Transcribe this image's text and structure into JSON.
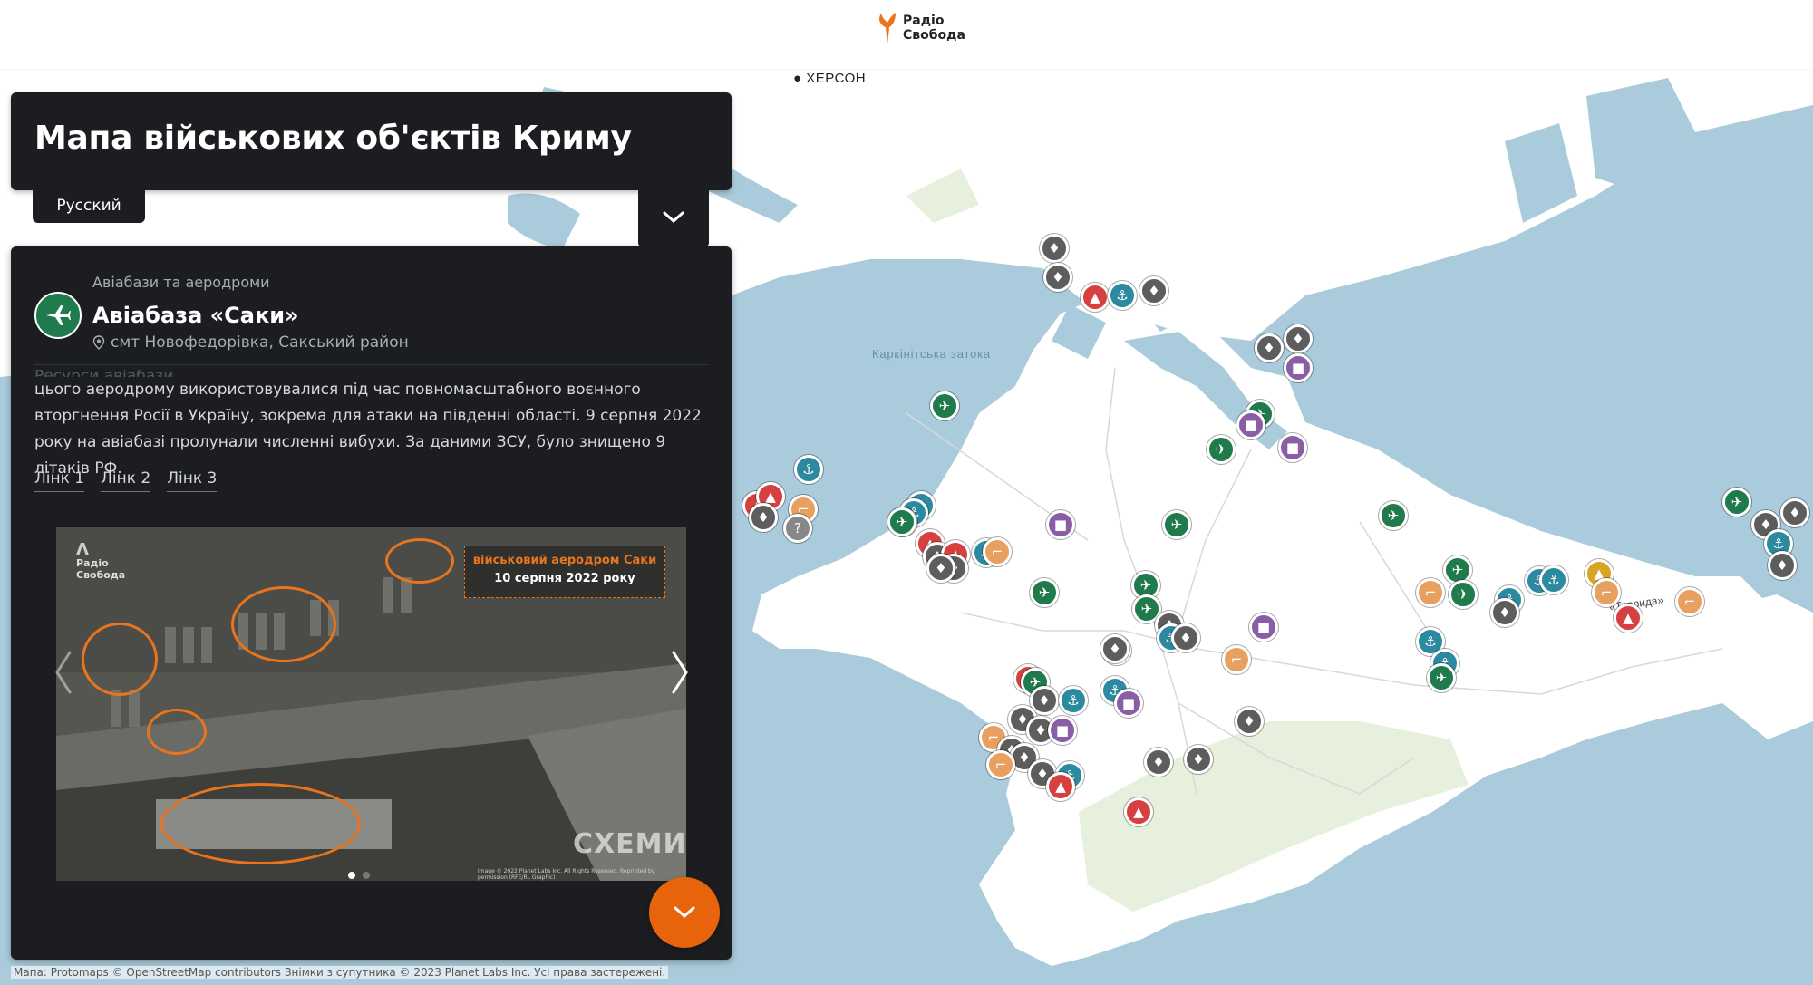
{
  "brand": {
    "line1": "Радіо",
    "line2": "Свобода",
    "accent": "#e8741e"
  },
  "map_labels": {
    "city": "ХЕРСОН",
    "bay": "Каркінітська затока",
    "road": "«Таврида»"
  },
  "header": {
    "title": "Мапа військових об'єктів Криму"
  },
  "language_button": {
    "label": "Русский"
  },
  "collapse_button": {
    "icon": "chevron-down-icon"
  },
  "place": {
    "category": "Авіабази та аеродроми",
    "title": "Авіабаза «Саки»",
    "location": "смт Новофедорівка, Сакський район",
    "description_cut": "Ресурси авіабази …",
    "description": "цього аеродрому використовувалися під час повномасштабного воєнного вторгнення Росії в Україну, зокрема для атаки на південні області. 9 серпня 2022 року на авіабазі пролунали численні вибухи. За даними ЗСУ, було знищено 9 літаків РФ.",
    "links": [
      "Лінк 1",
      "Лінк 2",
      "Лінк 3"
    ],
    "slide": {
      "caption_line1": "військовий аеродром Саки",
      "caption_line2": "10 серпня 2022 року",
      "watermark_brand_line1": "Радіо",
      "watermark_brand_line2": "Свобода",
      "watermark_project": "СХЕМИ",
      "credit": "Image © 2022 Planet Labs Inc. All Rights Reserved. Reprinted by permission (RFE/RL Graphic)",
      "current": 1,
      "total": 2
    }
  },
  "attribution": "Мапа: Protomaps © OpenStreetMap contributors Знімки з супутника © 2023 Planet Labs Inc. Усі права застережені.",
  "colors": {
    "panel": "#1b1d20",
    "water": "#aacbdb",
    "land": "#ffffff",
    "airbase": "#1f7a4c",
    "naval": "#2b8aa0",
    "hq": "#5d5d5d",
    "storage": "#8a5ea6",
    "missile": "#d64040",
    "weapons": "#e8a060",
    "accent_button": "#e8640c"
  }
}
